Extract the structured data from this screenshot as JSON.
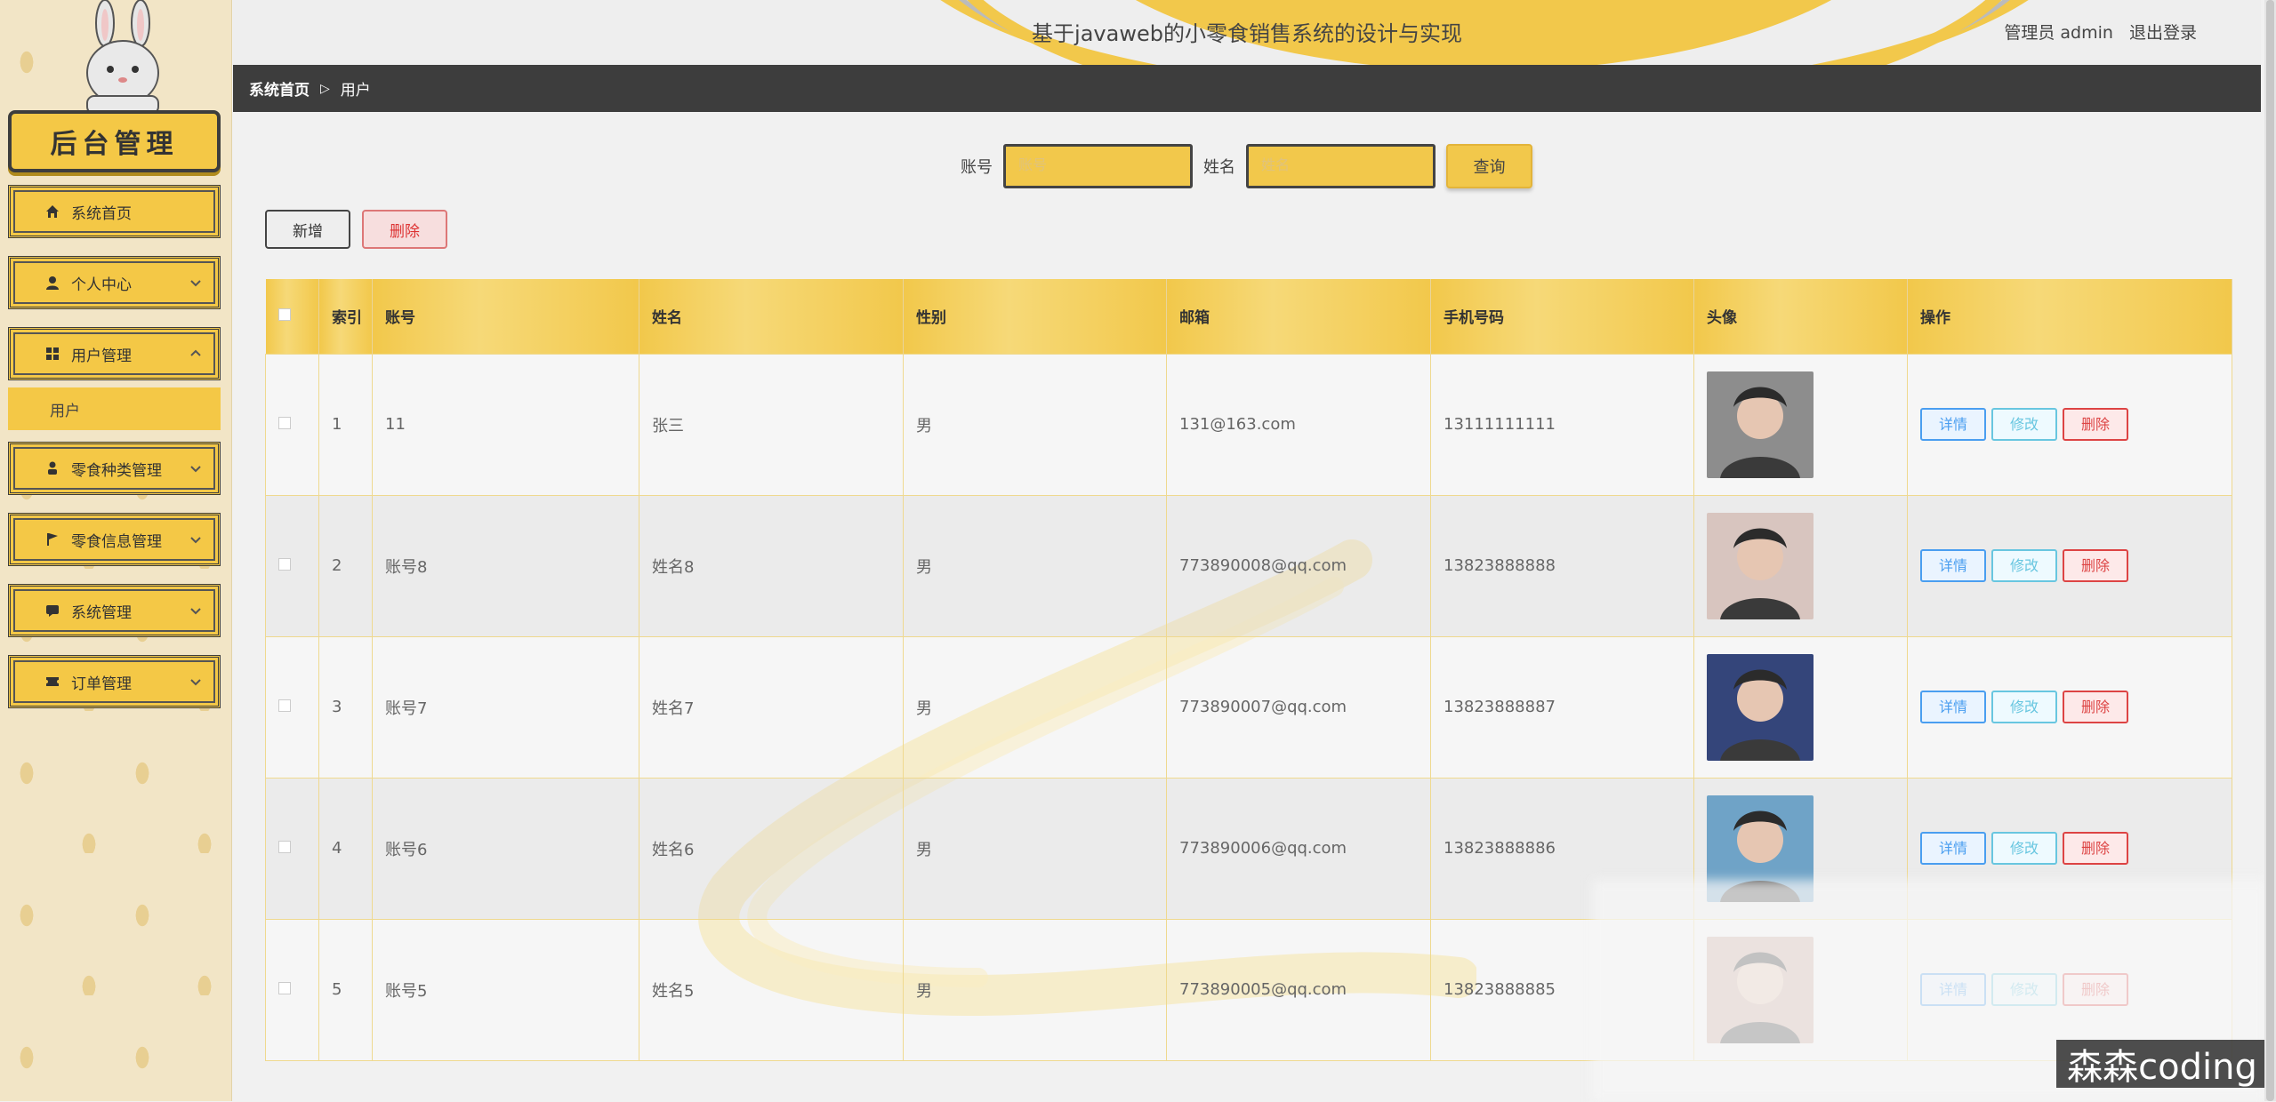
{
  "sidebar": {
    "logo_text": "后台管理",
    "items": [
      {
        "label": "系统首页",
        "icon": "home-icon",
        "has_chevron": false
      },
      {
        "label": "个人中心",
        "icon": "user-icon",
        "has_chevron": true
      },
      {
        "label": "用户管理",
        "icon": "grid-icon",
        "has_chevron": true,
        "expanded": true
      },
      {
        "label": "零食种类管理",
        "icon": "person-icon",
        "has_chevron": true
      },
      {
        "label": "零食信息管理",
        "icon": "flag-icon",
        "has_chevron": true
      },
      {
        "label": "系统管理",
        "icon": "chat-icon",
        "has_chevron": true
      },
      {
        "label": "订单管理",
        "icon": "ticket-icon",
        "has_chevron": true
      }
    ],
    "submenu": [
      {
        "label": "用户"
      }
    ]
  },
  "header": {
    "title": "基于javaweb的小零食销售系统的设计与实现",
    "user_label": "管理员 admin",
    "logout_label": "退出登录"
  },
  "breadcrumb": {
    "home": "系统首页",
    "current": "用户"
  },
  "search": {
    "account_label": "账号",
    "account_placeholder": "账号",
    "name_label": "姓名",
    "name_placeholder": "姓名",
    "query_button": "查询"
  },
  "actions": {
    "add": "新增",
    "delete": "删除"
  },
  "table": {
    "headers": [
      "",
      "索引",
      "账号",
      "姓名",
      "性别",
      "邮箱",
      "手机号码",
      "头像",
      "操作"
    ],
    "row_actions": {
      "detail": "详情",
      "edit": "修改",
      "delete": "删除"
    },
    "rows": [
      {
        "index": "1",
        "account": "11",
        "name": "张三",
        "gender": "男",
        "email": "131@163.com",
        "phone": "13111111111"
      },
      {
        "index": "2",
        "account": "账号8",
        "name": "姓名8",
        "gender": "男",
        "email": "773890008@qq.com",
        "phone": "13823888888"
      },
      {
        "index": "3",
        "account": "账号7",
        "name": "姓名7",
        "gender": "男",
        "email": "773890007@qq.com",
        "phone": "13823888887"
      },
      {
        "index": "4",
        "account": "账号6",
        "name": "姓名6",
        "gender": "男",
        "email": "773890006@qq.com",
        "phone": "13823888886"
      },
      {
        "index": "5",
        "account": "账号5",
        "name": "姓名5",
        "gender": "男",
        "email": "773890005@qq.com",
        "phone": "13823888885"
      }
    ]
  },
  "avatar_colors": [
    "#8d8d8d",
    "#d8c5bf",
    "#34457a",
    "#6fa3c7",
    "#c9a79a"
  ],
  "colors": {
    "accent": "#f2c84b",
    "dark": "#3d3d3d"
  },
  "watermark": "森森coding"
}
